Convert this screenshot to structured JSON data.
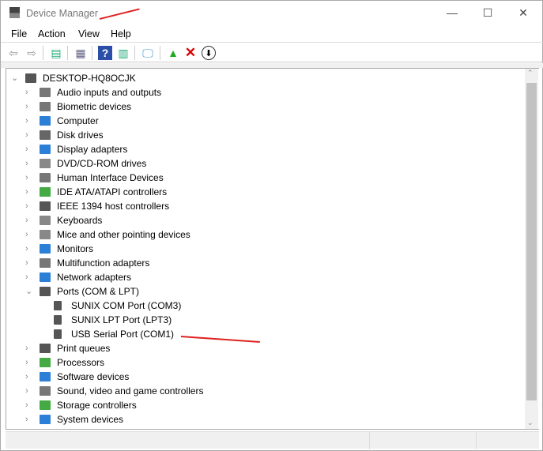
{
  "window": {
    "title": "Device Manager",
    "minimize": "—",
    "maximize": "☐",
    "close": "✕"
  },
  "menu": [
    "File",
    "Action",
    "View",
    "Help"
  ],
  "toolbar": [
    "back-icon",
    "forward-icon",
    "console-tree-icon",
    "properties-icon",
    "help-icon",
    "action-pane-icon",
    "scan-hardware-icon",
    "update-driver-icon",
    "uninstall-icon",
    "disable-icon"
  ],
  "colors": {
    "accent": "#0078d7",
    "annotation": "#e02020"
  },
  "tree": {
    "root": "DESKTOP-HQ8OCJK",
    "categories": [
      "Audio inputs and outputs",
      "Biometric devices",
      "Computer",
      "Disk drives",
      "Display adapters",
      "DVD/CD-ROM drives",
      "Human Interface Devices",
      "IDE ATA/ATAPI controllers",
      "IEEE 1394 host controllers",
      "Keyboards",
      "Mice and other pointing devices",
      "Monitors",
      "Multifunction adapters",
      "Network adapters",
      "Ports (COM & LPT)",
      "Print queues",
      "Processors",
      "Software devices",
      "Sound, video and game controllers",
      "Storage controllers",
      "System devices"
    ],
    "ports_children": [
      "SUNIX COM Port (COM3)",
      "SUNIX LPT Port (LPT3)",
      "USB Serial Port (COM1)"
    ]
  }
}
